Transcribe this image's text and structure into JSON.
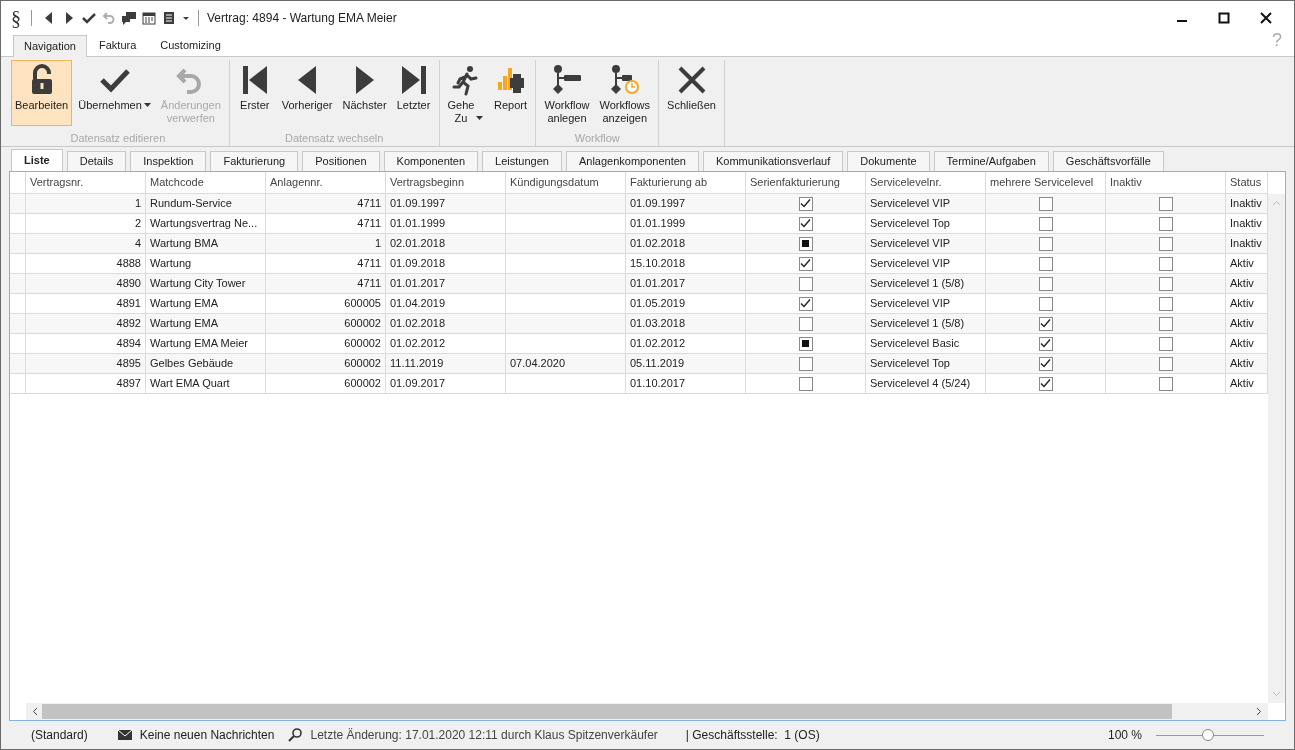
{
  "window": {
    "app_symbol": "§",
    "title": "Vertrag: 4894 - Wartung EMA Meier",
    "help": "?"
  },
  "quick_access": [
    {
      "disabled": false
    },
    {
      "disabled": false
    },
    {
      "disabled": false
    },
    {
      "disabled": true
    },
    {
      "disabled": false
    },
    {
      "disabled": false
    },
    {
      "disabled": false
    },
    {
      "disabled": false
    }
  ],
  "ribbon_tabs": [
    {
      "label": "Navigation",
      "selected": true
    },
    {
      "label": "Faktura",
      "selected": false
    },
    {
      "label": "Customizing",
      "selected": false
    }
  ],
  "ribbon_groups": [
    {
      "label": "Datensatz editieren",
      "buttons": [
        {
          "label": "Bearbeiten",
          "selected": true,
          "disabled": false,
          "dropdown": false
        },
        {
          "label": "Übernehmen",
          "selected": false,
          "disabled": false,
          "dropdown": true
        },
        {
          "label": "Änderungen\nverwerfen",
          "selected": false,
          "disabled": true,
          "dropdown": false
        }
      ]
    },
    {
      "label": "Datensatz wechseln",
      "buttons": [
        {
          "label": "Erster",
          "selected": false,
          "disabled": false,
          "dropdown": false
        },
        {
          "label": "Vorheriger",
          "selected": false,
          "disabled": false,
          "dropdown": false
        },
        {
          "label": "Nächster",
          "selected": false,
          "disabled": false,
          "dropdown": false
        },
        {
          "label": "Letzter",
          "selected": false,
          "disabled": false,
          "dropdown": false
        }
      ]
    },
    {
      "buttons": [
        {
          "label": "Gehe\nZu",
          "selected": false,
          "disabled": false,
          "dropdown": true
        },
        {
          "label": "Report",
          "selected": false,
          "disabled": false,
          "dropdown": false
        }
      ]
    },
    {
      "label": "Workflow",
      "buttons": [
        {
          "label": "Workflow\nanlegen",
          "selected": false,
          "disabled": false,
          "dropdown": false
        },
        {
          "label": "Workflows\nanzeigen",
          "selected": false,
          "disabled": false,
          "dropdown": false
        }
      ]
    },
    {
      "buttons": [
        {
          "label": "Schließen",
          "selected": false,
          "disabled": false,
          "dropdown": false
        }
      ]
    }
  ],
  "doc_tabs": [
    {
      "label": "Liste",
      "selected": true
    },
    {
      "label": "Details",
      "selected": false
    },
    {
      "label": "Inspektion",
      "selected": false
    },
    {
      "label": "Fakturierung",
      "selected": false
    },
    {
      "label": "Positionen",
      "selected": false
    },
    {
      "label": "Komponenten",
      "selected": false
    },
    {
      "label": "Leistungen",
      "selected": false
    },
    {
      "label": "Anlagenkomponenten",
      "selected": false
    },
    {
      "label": "Kommunikationsverlauf",
      "selected": false
    },
    {
      "label": "Dokumente",
      "selected": false
    },
    {
      "label": "Termine/Aufgaben",
      "selected": false
    },
    {
      "label": "Geschäftsvorfälle",
      "selected": false
    }
  ],
  "table": {
    "columns": [
      "Vertragsnr.",
      "Matchcode",
      "Anlagennr.",
      "Vertragsbeginn",
      "Kündigungsdatum",
      "Fakturierung ab",
      "Serienfakturierung",
      "Servicelevelnr.",
      "mehrere Servicelevel",
      "Inaktiv",
      "Status"
    ],
    "rows": [
      {
        "vertragsnr": "1",
        "matchcode": "Rundum-Service",
        "anlagennr": "4711",
        "vertragsbeginn": "01.09.1997",
        "fakturierung_ab": "01.09.1997",
        "serienfakturierung": {
          "checked": true
        },
        "servicelevelnr": "Servicelevel VIP",
        "mehrere_servicelevel": false,
        "inaktiv": false,
        "status": "Inaktiv"
      },
      {
        "vertragsnr": "2",
        "matchcode": "Wartungsvertrag Ne...",
        "anlagennr": "4711",
        "vertragsbeginn": "01.01.1999",
        "fakturierung_ab": "01.01.1999",
        "serienfakturierung": {
          "checked": true
        },
        "servicelevelnr": "Servicelevel Top",
        "mehrere_servicelevel": false,
        "inaktiv": false,
        "status": "Inaktiv"
      },
      {
        "vertragsnr": "4",
        "matchcode": "Wartung BMA",
        "anlagennr": "1",
        "vertragsbeginn": "02.01.2018",
        "fakturierung_ab": "01.02.2018",
        "serienfakturierung": {
          "checked": true,
          "mixed": true
        },
        "servicelevelnr": "Servicelevel VIP",
        "mehrere_servicelevel": false,
        "inaktiv": false,
        "status": "Inaktiv"
      },
      {
        "vertragsnr": "4888",
        "matchcode": "Wartung",
        "anlagennr": "4711",
        "vertragsbeginn": "01.09.2018",
        "fakturierung_ab": "15.10.2018",
        "serienfakturierung": {
          "checked": true
        },
        "servicelevelnr": "Servicelevel VIP",
        "mehrere_servicelevel": false,
        "inaktiv": false,
        "status": "Aktiv"
      },
      {
        "vertragsnr": "4890",
        "matchcode": "Wartung City Tower",
        "anlagennr": "4711",
        "vertragsbeginn": "01.01.2017",
        "fakturierung_ab": "01.01.2017",
        "serienfakturierung": {
          "checked": false
        },
        "servicelevelnr": "Servicelevel 1 (5/8)",
        "mehrere_servicelevel": false,
        "inaktiv": false,
        "status": "Aktiv"
      },
      {
        "vertragsnr": "4891",
        "matchcode": "Wartung EMA",
        "anlagennr": "600005",
        "vertragsbeginn": "01.04.2019",
        "fakturierung_ab": "01.05.2019",
        "serienfakturierung": {
          "checked": true
        },
        "servicelevelnr": "Servicelevel VIP",
        "mehrere_servicelevel": false,
        "inaktiv": false,
        "status": "Aktiv"
      },
      {
        "vertragsnr": "4892",
        "matchcode": "Wartung EMA",
        "anlagennr": "600002",
        "vertragsbeginn": "01.02.2018",
        "fakturierung_ab": "01.03.2018",
        "serienfakturierung": {
          "checked": false
        },
        "servicelevelnr": "Servicelevel 1 (5/8)",
        "mehrere_servicelevel": true,
        "inaktiv": false,
        "status": "Aktiv"
      },
      {
        "vertragsnr": "4894",
        "matchcode": "Wartung EMA Meier",
        "anlagennr": "600002",
        "vertragsbeginn": "01.02.2012",
        "fakturierung_ab": "01.02.2012",
        "serienfakturierung": {
          "checked": true,
          "mixed": true
        },
        "servicelevelnr": "Servicelevel Basic",
        "mehrere_servicelevel": true,
        "inaktiv": false,
        "status": "Aktiv"
      },
      {
        "vertragsnr": "4895",
        "matchcode": "Gelbes Gebäude",
        "anlagennr": "600002",
        "vertragsbeginn": "11.11.2019",
        "kuendigungsdatum": "07.04.2020",
        "fakturierung_ab": "05.11.2019",
        "serienfakturierung": {
          "checked": false
        },
        "servicelevelnr": "Servicelevel Top",
        "mehrere_servicelevel": true,
        "inaktiv": false,
        "status": "Aktiv"
      },
      {
        "vertragsnr": "4897",
        "matchcode": "Wart EMA Quart",
        "anlagennr": "600002",
        "vertragsbeginn": "01.09.2017",
        "fakturierung_ab": "01.10.2017",
        "serienfakturierung": {
          "checked": false
        },
        "servicelevelnr": "Servicelevel 4 (5/24)",
        "mehrere_servicelevel": true,
        "inaktiv": false,
        "status": "Aktiv"
      }
    ]
  },
  "status_bar": {
    "layout": "(Standard)",
    "messages": "Keine neuen Nachrichten",
    "last_change": "Letzte Änderung: 17.01.2020 12:11 durch Klaus Spitzenverkäufer",
    "branch": "| Geschäftsstelle:  1 (OS)",
    "zoom": "100 %",
    "zoom_slider": {
      "level": 0.48
    }
  }
}
